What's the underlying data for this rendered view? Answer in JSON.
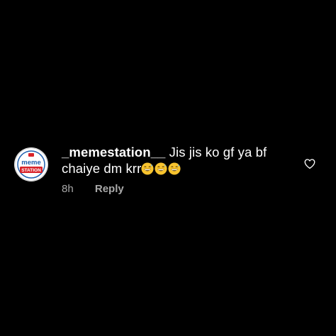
{
  "comment": {
    "username": "_memestation__",
    "text": "Jis jis ko gf ya bf chaiye dm krr",
    "time": "8h",
    "reply_label": "Reply"
  },
  "avatar": {
    "logo_line1": "meme",
    "logo_line2": "STATION"
  },
  "icons": {
    "like": "heart-outline-icon",
    "emoji": "grinning-face-with-sweat-emoji"
  },
  "colors": {
    "background": "#000000",
    "text": "#ffffff",
    "meta": "#a8a8a8",
    "logo_blue": "#1f5fae",
    "logo_red": "#d8232a",
    "emoji_yellow": "#f7c32e"
  }
}
